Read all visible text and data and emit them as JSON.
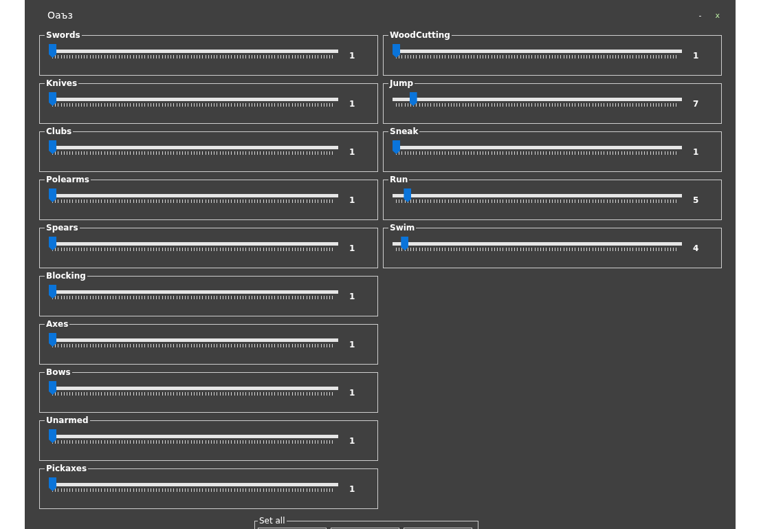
{
  "window": {
    "title": "Оаъз",
    "minimize": "-",
    "close": "x"
  },
  "left_column": [
    {
      "label": "Swords",
      "level": 0,
      "reading": "1"
    },
    {
      "label": "Knives",
      "level": 0,
      "reading": "1"
    },
    {
      "label": "Clubs",
      "level": 0,
      "reading": "1"
    },
    {
      "label": "Polearms",
      "level": 0,
      "reading": "1"
    },
    {
      "label": "Spears",
      "level": 0,
      "reading": "1"
    },
    {
      "label": "Blocking",
      "level": 0,
      "reading": "1"
    },
    {
      "label": "Axes",
      "level": 0,
      "reading": "1"
    },
    {
      "label": "Bows",
      "level": 0,
      "reading": "1"
    },
    {
      "label": "Unarmed",
      "level": 0,
      "reading": "1"
    },
    {
      "label": "Pickaxes",
      "level": 0,
      "reading": "1"
    }
  ],
  "right_column": [
    {
      "label": "WoodCutting",
      "level": 0,
      "reading": "1"
    },
    {
      "label": "Jump",
      "level": 0.06,
      "reading": "7"
    },
    {
      "label": "Sneak",
      "level": 0,
      "reading": "1"
    },
    {
      "label": "Run",
      "level": 0.04,
      "reading": "5"
    },
    {
      "label": "Swim",
      "level": 0.03,
      "reading": "4"
    }
  ],
  "set_all": {
    "label": "Set all"
  }
}
